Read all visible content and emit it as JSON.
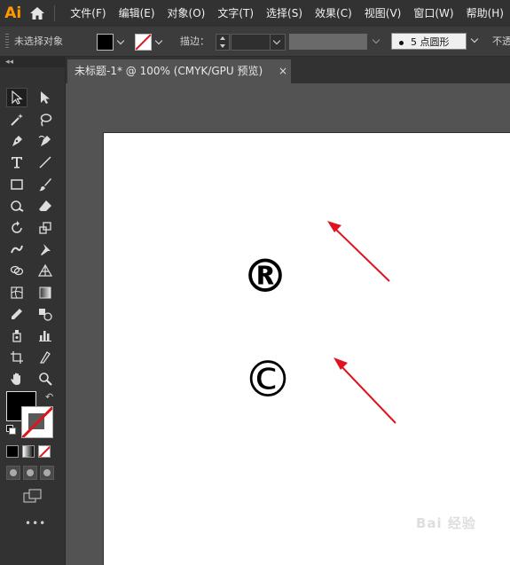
{
  "app": {
    "logo": "Ai"
  },
  "menubar": {
    "items": [
      "文件(F)",
      "编辑(E)",
      "对象(O)",
      "文字(T)",
      "选择(S)",
      "效果(C)",
      "视图(V)",
      "窗口(W)",
      "帮助(H)"
    ]
  },
  "controlbar": {
    "selection_status": "未选择对象",
    "stroke_label": "描边：",
    "brush_size": "5",
    "brush_name": "点圆形",
    "opacity_label": "不透"
  },
  "tools_panel": {
    "collapse_glyph": "◂◂",
    "swap_glyph": "↶",
    "more_glyph": "•••"
  },
  "document": {
    "tab_title": "未标题-1* @ 100% (CMYK/GPU 预览)",
    "close_glyph": "×"
  },
  "artboard": {
    "registered_symbol": "®",
    "copyright_symbol": "©"
  },
  "annotations": {
    "arrow_color": "#e0141e"
  },
  "watermark": {
    "text": "Bai 经验"
  },
  "colors": {
    "menubar_bg": "#323232",
    "panel_bg": "#535353",
    "logo": "#ff9a00",
    "artboard": "#ffffff"
  }
}
